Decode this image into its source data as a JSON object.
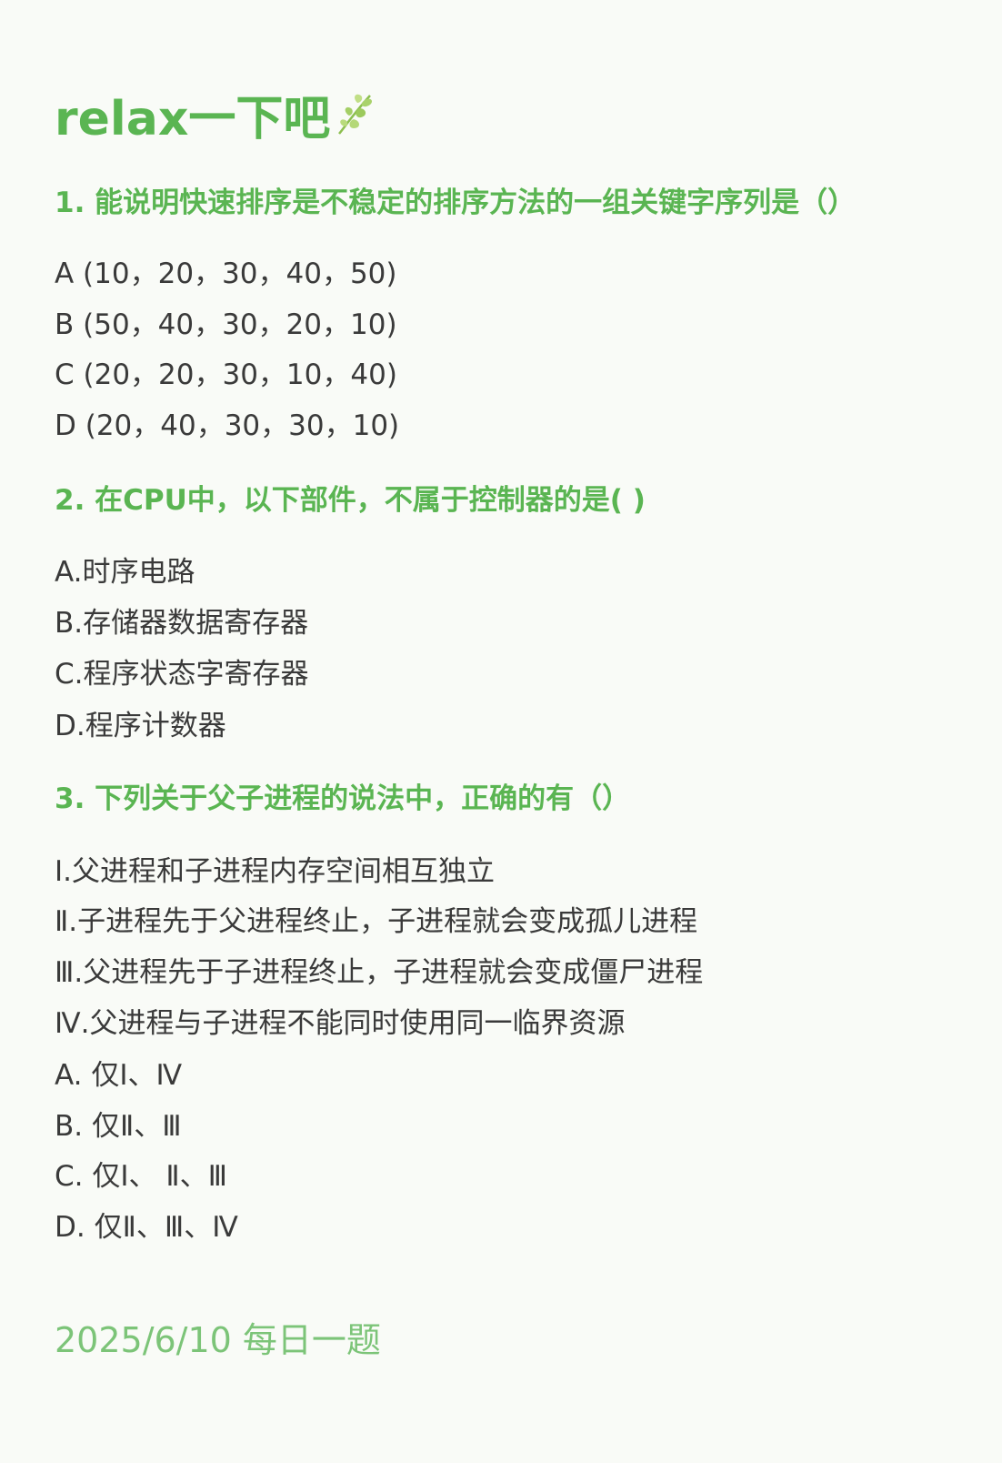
{
  "heading": "relax一下吧",
  "leaf_icon": "leaf-icon",
  "colors": {
    "accent": "#5ab552",
    "footer": "#7cc478",
    "text": "#3a3a3a",
    "background": "#f9fbf7"
  },
  "questions": [
    {
      "title": "1. 能说明快速排序是不稳定的排序方法的一组关键字序列是（）",
      "options": [
        "A (10，20，30，40，50)",
        "B (50，40，30，20，10)",
        "C (20，20，30，10，40)",
        "D (20，40，30，30，10)"
      ]
    },
    {
      "title": "2. 在CPU中，以下部件，不属于控制器的是( )",
      "options": [
        "A.时序电路",
        "B.存储器数据寄存器",
        "C.程序状态字寄存器",
        "D.程序计数器"
      ]
    },
    {
      "title": "3. 下列关于父子进程的说法中，正确的有（）",
      "statements": [
        "Ⅰ.父进程和子进程内存空间相互独立",
        "Ⅱ.子进程先于父进程终止，子进程就会变成孤儿进程",
        "Ⅲ.父进程先于子进程终止，子进程就会变成僵尸进程",
        "Ⅳ.父进程与子进程不能同时使用同一临界资源"
      ],
      "options": [
        "A. 仅Ⅰ、Ⅳ",
        "B. 仅Ⅱ、Ⅲ",
        "C. 仅Ⅰ、 Ⅱ、Ⅲ",
        "D. 仅Ⅱ、Ⅲ、Ⅳ"
      ]
    }
  ],
  "footer": "2025/6/10 每日一题"
}
